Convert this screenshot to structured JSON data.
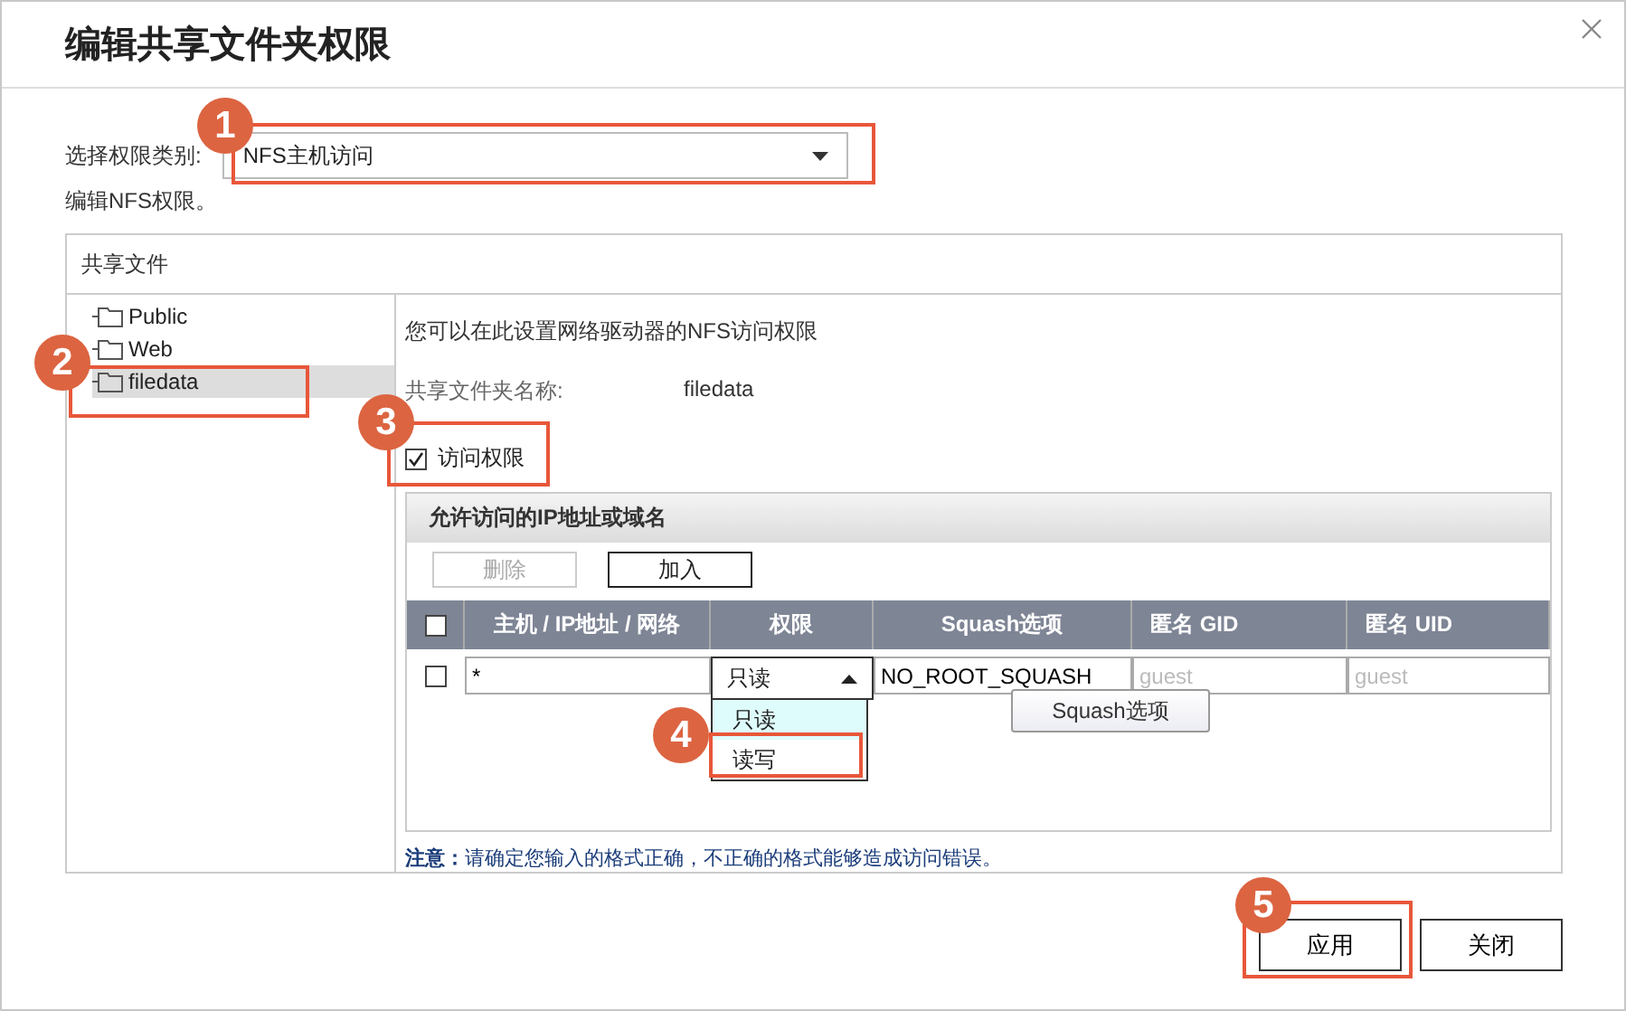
{
  "dialog": {
    "title": "编辑共享文件夹权限"
  },
  "category": {
    "label": "选择权限类别:",
    "value": "NFS主机访问"
  },
  "subtitle": "编辑NFS权限。",
  "panel": {
    "title": "共享文件",
    "tree": [
      {
        "label": "Public",
        "selected": false
      },
      {
        "label": "Web",
        "selected": false
      },
      {
        "label": "filedata",
        "selected": true
      }
    ],
    "intro": "您可以在此设置网络驱动器的NFS访问权限",
    "folder_label": "共享文件夹名称:",
    "folder_value": "filedata",
    "access": {
      "label": "访问权限",
      "checked": true
    },
    "hosts": {
      "title": "允许访问的IP地址或域名",
      "buttons": [
        {
          "label": "删除",
          "disabled": true
        },
        {
          "label": "加入",
          "disabled": false
        }
      ],
      "header_checked": false,
      "columns": [
        "主机 / IP地址 / 网络",
        "权限",
        "Squash选项",
        "匿名 GID",
        "匿名 UID"
      ],
      "rows": [
        {
          "checked": false,
          "host": "*",
          "permission": "只读",
          "squash": "NO_ROOT_SQUASH",
          "gid_placeholder": "guest",
          "uid_placeholder": "guest"
        }
      ],
      "permission_options": [
        {
          "label": "只读",
          "selected": true
        },
        {
          "label": "读写",
          "selected": false
        }
      ],
      "tooltip": "Squash选项"
    },
    "note": "**注意：**请确定您输入的格式正确，不正确的格式能够造成访问错误。"
  },
  "buttons": [
    "应用",
    "关闭"
  ],
  "callouts": [
    "1",
    "2",
    "3",
    "4",
    "5"
  ]
}
